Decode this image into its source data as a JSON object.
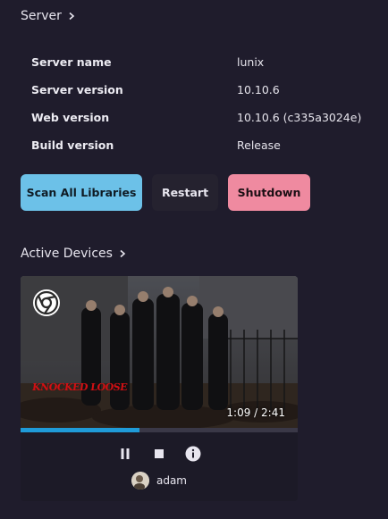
{
  "server": {
    "title": "Server",
    "rows": [
      {
        "label": "Server name",
        "value": "lunix"
      },
      {
        "label": "Server version",
        "value": "10.10.6"
      },
      {
        "label": "Web version",
        "value": "10.10.6 (c335a3024e)"
      },
      {
        "label": "Build version",
        "value": "Release"
      }
    ]
  },
  "actions": {
    "scan_label": "Scan All Libraries",
    "restart_label": "Restart",
    "shutdown_label": "Shutdown"
  },
  "devices": {
    "title": "Active Devices",
    "items": [
      {
        "client_icon": "chrome-icon",
        "overlay_text": "KNOCKED LOOSE",
        "playback_time": "1:09 / 2:41",
        "progress_fraction": 0.43,
        "user": "adam"
      }
    ]
  },
  "colors": {
    "background": "#1f1c2c",
    "scan": "#6cc1e8",
    "restart": "#25222f",
    "shutdown": "#ef8aa0",
    "progress": "#1f9bd8"
  }
}
